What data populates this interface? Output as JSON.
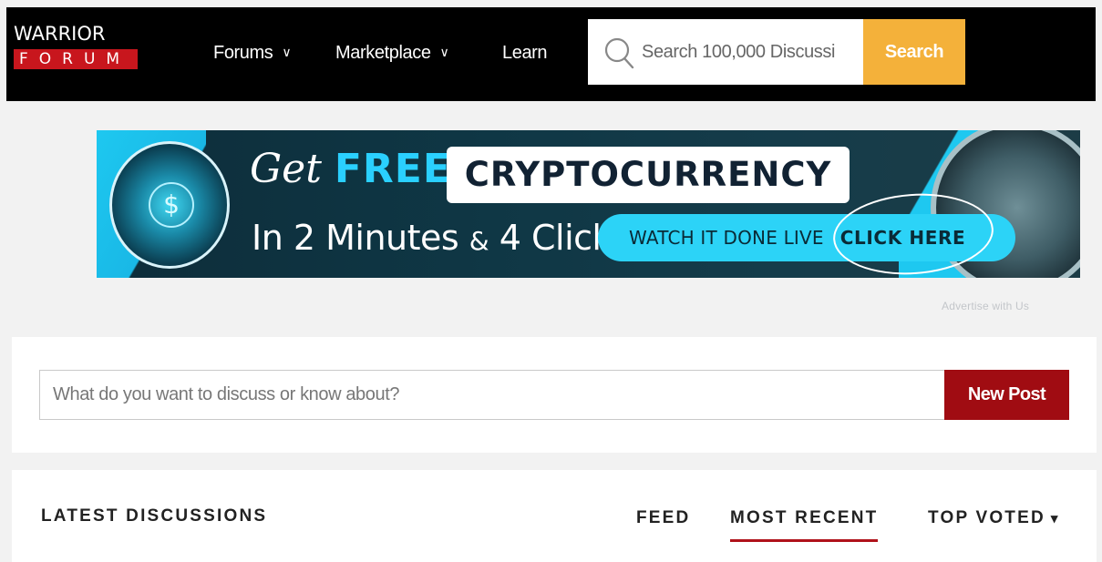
{
  "header": {
    "logo_top": "WARRIOR",
    "logo_bottom": "FORUM",
    "nav": [
      {
        "label": "Forums",
        "dropdown": true
      },
      {
        "label": "Marketplace",
        "dropdown": true
      },
      {
        "label": "Learn",
        "dropdown": false
      }
    ],
    "search_placeholder": "Search 100,000 Discussi",
    "search_button": "Search"
  },
  "banner": {
    "get": "Get ",
    "free": "FREE",
    "crypto": "CRYPTOCURRENCY",
    "line2_a": "In 2 Minutes ",
    "line2_amp": "&",
    "line2_b": " 4 Clicks",
    "watch": "WATCH IT DONE LIVE",
    "click": "CLICK HERE",
    "dollar": "$"
  },
  "advertise": "Advertise with Us",
  "composer": {
    "placeholder": "What do you want to discuss or know about?",
    "button": "New Post"
  },
  "discussions": {
    "heading": "LATEST DISCUSSIONS",
    "tabs": [
      {
        "label": "FEED",
        "active": false
      },
      {
        "label": "MOST RECENT",
        "active": true
      },
      {
        "label": "TOP VOTED",
        "active": false
      }
    ],
    "dropdown_arrow": "▾"
  },
  "colors": {
    "topbar": "#000000",
    "logo_red": "#c8161d",
    "search_button": "#f4b13a",
    "new_post": "#a00c12",
    "active_underline": "#b0121a",
    "banner_cyan": "#2cd3f7"
  }
}
